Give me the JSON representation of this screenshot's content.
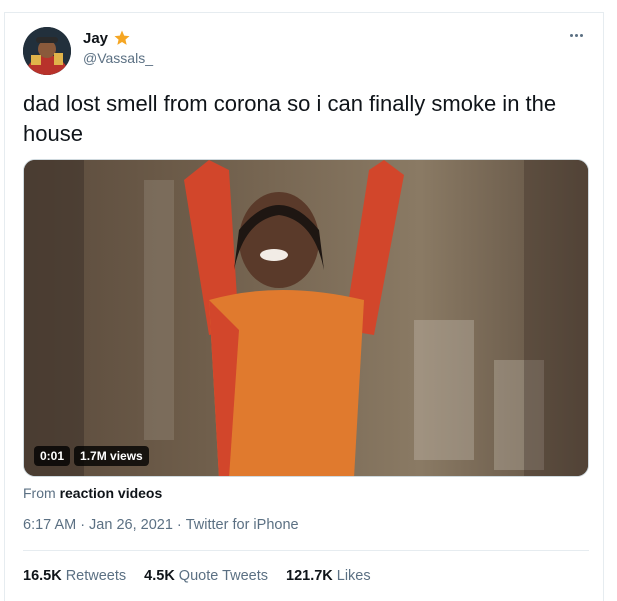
{
  "author": {
    "name": "Jay",
    "handle": "@Vassals_",
    "badge_icon": "star-icon",
    "badge_color": "#f5a623"
  },
  "tweet": {
    "text": "dad lost smell from corona so i can finally smoke in the house"
  },
  "media": {
    "duration": "0:01",
    "views": "1.7M views"
  },
  "source": {
    "prefix": "From",
    "name": "reaction videos"
  },
  "meta": {
    "time": "6:17 AM",
    "date": "Jan 26, 2021",
    "client": "Twitter for iPhone",
    "separator": "·"
  },
  "stats": {
    "retweets_count": "16.5K",
    "retweets_label": "Retweets",
    "quotes_count": "4.5K",
    "quotes_label": "Quote Tweets",
    "likes_count": "121.7K",
    "likes_label": "Likes"
  },
  "colors": {
    "secondary_text": "#5b7083",
    "divider": "#e6ecf0"
  }
}
